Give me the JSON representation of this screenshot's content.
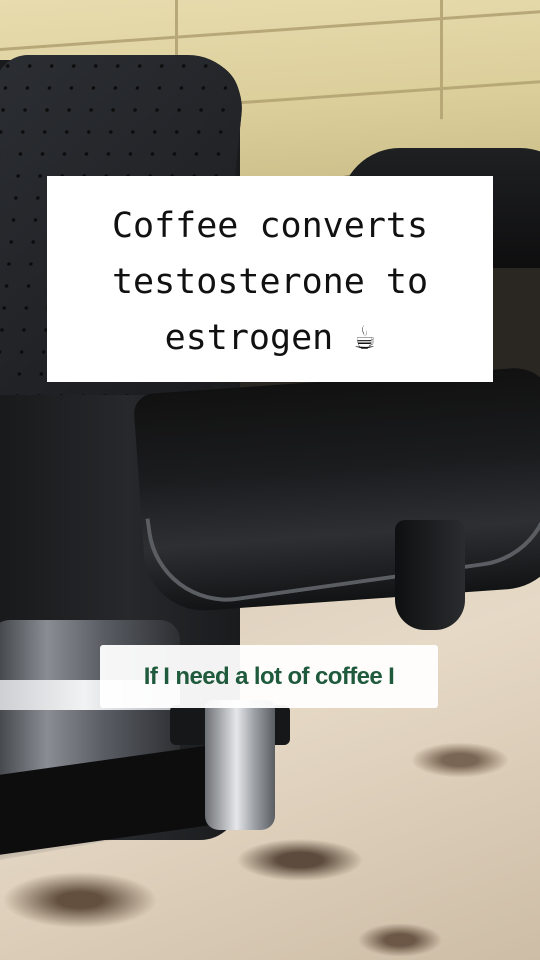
{
  "headline": {
    "lines": [
      "Coffee converts",
      "testosterone to",
      "estrogen ☕"
    ]
  },
  "subtitle": {
    "text": "If I need a lot of coffee I"
  },
  "colors": {
    "headline_bg": "#ffffff",
    "headline_text": "#111111",
    "subtitle_text": "#1f5a3c"
  }
}
